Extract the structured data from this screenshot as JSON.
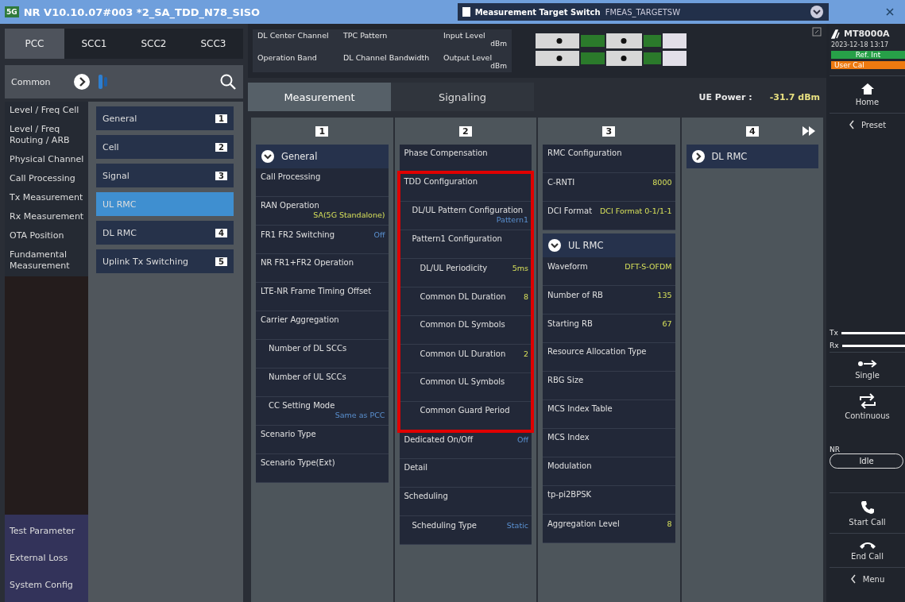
{
  "title_bar": {
    "badge": "5G",
    "title": "NR V10.10.07#003  *2_SA_TDD_N78_SISO",
    "switch_label": "Measurement Target Switch",
    "switch_value": "FMEAS_TARGETSW"
  },
  "carrier_tabs": [
    {
      "label": "PCC",
      "selected": true
    },
    {
      "label": "SCC1",
      "selected": false
    },
    {
      "label": "SCC2",
      "selected": false
    },
    {
      "label": "SCC3",
      "selected": false
    }
  ],
  "common": {
    "label": "Common"
  },
  "categories": [
    {
      "label": "Level / Freq Cell"
    },
    {
      "label": "Level / Freq Routing / ARB"
    },
    {
      "label": "Physical Channel"
    },
    {
      "label": "Call Processing"
    },
    {
      "label": "Tx Measurement"
    },
    {
      "label": "Rx Measurement"
    },
    {
      "label": "OTA Position"
    },
    {
      "label": "Fundamental Measurement"
    }
  ],
  "bottom_categories": [
    {
      "label": "Test Parameter"
    },
    {
      "label": "External Loss"
    },
    {
      "label": "System Config"
    }
  ],
  "items": [
    {
      "label": "General",
      "number": "1",
      "selected": false
    },
    {
      "label": "Cell",
      "number": "2",
      "selected": false
    },
    {
      "label": "Signal",
      "number": "3",
      "selected": false
    },
    {
      "label": "UL RMC",
      "selected": true
    },
    {
      "label": "DL RMC",
      "number": "4",
      "selected": false
    },
    {
      "label": "Uplink Tx Switching",
      "number": "5",
      "selected": false
    }
  ],
  "params": [
    {
      "label": "DL Center Channel"
    },
    {
      "label": "TPC Pattern"
    },
    {
      "label": "Input Level",
      "unit": "dBm"
    },
    {
      "label": "Operation Band"
    },
    {
      "label": "DL Channel Bandwidth"
    },
    {
      "label": "Output Level",
      "unit": "dBm"
    }
  ],
  "instrument": {
    "model": "MT8000A",
    "datetime": "2023-12-18 13:17",
    "ref": "Ref. Int",
    "cal": "User Cal"
  },
  "view_tabs": [
    {
      "label": "Measurement",
      "selected": true
    },
    {
      "label": "Signaling",
      "selected": false
    }
  ],
  "ue_power": {
    "label": "UE Power :",
    "value": "-31.7 dBm"
  },
  "columns": [
    {
      "number": "1",
      "sections": [
        {
          "title": "General",
          "expanded": true,
          "rows": [
            {
              "label": "Call Processing"
            },
            {
              "label": "RAN Operation",
              "value": "SA(5G Standalone)",
              "highlighted": true
            },
            {
              "label": "FR1 FR2 Switching",
              "value": "Off",
              "highlighted": false
            },
            {
              "label": "NR FR1+FR2 Operation"
            },
            {
              "label": "LTE-NR Frame Timing Offset"
            },
            {
              "label": "Carrier Aggregation",
              "children": [
                {
                  "label": "Number of DL SCCs"
                },
                {
                  "label": "Number of UL SCCs"
                },
                {
                  "label": "CC Setting Mode",
                  "value": "Same as PCC",
                  "highlighted": false
                }
              ]
            },
            {
              "label": "Scenario Type"
            },
            {
              "label": "Scenario Type(Ext)"
            }
          ]
        }
      ]
    },
    {
      "number": "2",
      "rows": [
        {
          "label": "Phase Compensation"
        },
        {
          "label": "TDD Configuration",
          "outlined": true,
          "children": [
            {
              "label": "DL/UL Pattern Configuration",
              "value": "Pattern1",
              "highlighted": false
            },
            {
              "label": "Pattern1 Configuration",
              "children": [
                {
                  "label": "DL/UL Periodicity",
                  "value": "5ms",
                  "highlighted": true
                },
                {
                  "label": "Common DL Duration",
                  "value": "8",
                  "highlighted": true
                },
                {
                  "label": "Common DL Symbols"
                },
                {
                  "label": "Common UL Duration",
                  "value": "2",
                  "highlighted": true
                },
                {
                  "label": "Common UL Symbols"
                },
                {
                  "label": "Common Guard Period"
                }
              ]
            }
          ]
        },
        {
          "label": "Dedicated On/Off",
          "value": "Off",
          "highlighted": false
        },
        {
          "label": "Detail"
        },
        {
          "label": "Scheduling",
          "children": [
            {
              "label": "Scheduling Type",
              "value": "Static",
              "highlighted": false
            }
          ]
        }
      ]
    },
    {
      "number": "3",
      "rows": [
        {
          "label": "RMC Configuration"
        },
        {
          "label": "C-RNTI",
          "value": "8000",
          "highlighted": true
        },
        {
          "label": "DCI Format",
          "value": "DCI Format 0-1/1-1",
          "highlighted": true
        }
      ],
      "sections": [
        {
          "title": "UL RMC",
          "expanded": true,
          "rows": [
            {
              "label": "Waveform",
              "value": "DFT-S-OFDM",
              "highlighted": true
            },
            {
              "label": "Number of RB",
              "value": "135",
              "highlighted": true
            },
            {
              "label": "Starting RB",
              "value": "67",
              "highlighted": true
            },
            {
              "label": "Resource Allocation Type"
            },
            {
              "label": "RBG Size"
            },
            {
              "label": "MCS Index Table"
            },
            {
              "label": "MCS Index"
            },
            {
              "label": "Modulation"
            },
            {
              "label": "tp-pi2BPSK"
            },
            {
              "label": "Aggregation Level",
              "value": "8",
              "highlighted": true
            }
          ]
        }
      ]
    },
    {
      "number": "4",
      "sections": [
        {
          "title": "DL RMC",
          "expanded": false
        }
      ]
    }
  ],
  "top_buttons": [
    {
      "label": "Home",
      "kind": "home"
    },
    {
      "label": "Preset",
      "kind": "preset"
    }
  ],
  "links": [
    {
      "label": "Tx"
    },
    {
      "label": "Rx"
    }
  ],
  "mode_buttons": [
    {
      "label": "Single",
      "kind": "single"
    },
    {
      "label": "Continuous",
      "kind": "continuous"
    }
  ],
  "nr": {
    "label": "NR",
    "state": "Idle"
  },
  "call_buttons": [
    {
      "label": "Start Call",
      "kind": "start"
    },
    {
      "label": "End Call",
      "kind": "end"
    },
    {
      "label": "Menu",
      "kind": "menu"
    }
  ]
}
